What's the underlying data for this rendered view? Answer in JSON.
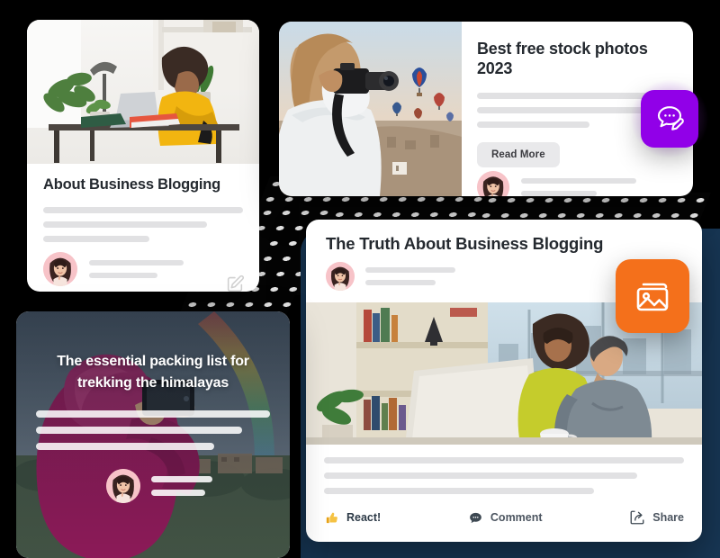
{
  "page": {
    "background_color": "#000000",
    "navy_panel_color": "#173654",
    "pattern": "white-ellipse-dots-on-black"
  },
  "cards": {
    "blogging": {
      "title": "About Business Blogging",
      "image_alt": "woman-working-on-laptop-at-desk",
      "edit_icon": "edit-pencil-square-icon",
      "skeleton_lines": 3,
      "author_lines": 2
    },
    "stock": {
      "title": "Best free stock photos 2023",
      "image_alt": "photographer-with-camera-and-hot-air-balloons",
      "read_more_label": "Read More",
      "edit_icon": "edit-pencil-square-icon",
      "skeleton_lines": 3,
      "author_lines": 2
    },
    "truth": {
      "title": "The Truth About Business Blogging",
      "image_alt": "two-colleagues-at-desktop-computer-in-office",
      "skeleton_lines": 3,
      "author_lines": 2,
      "actions": [
        {
          "label": "React!",
          "icon": "thumbs-up-icon"
        },
        {
          "label": "Comment",
          "icon": "comment-bubble-icon"
        },
        {
          "label": "Share",
          "icon": "share-arrow-icon"
        }
      ]
    },
    "packing": {
      "title": "The essential packing list for trekking the himalayas",
      "image_alt": "person-in-magenta-raincoat-photographing-rainbow",
      "skeleton_lines": 3,
      "author_lines": 2
    }
  },
  "badges": {
    "chat": {
      "icon": "chat-bubble-edit-icon",
      "color": "#9100e8"
    },
    "image": {
      "icon": "image-gallery-icon",
      "color": "#f4701b"
    }
  }
}
